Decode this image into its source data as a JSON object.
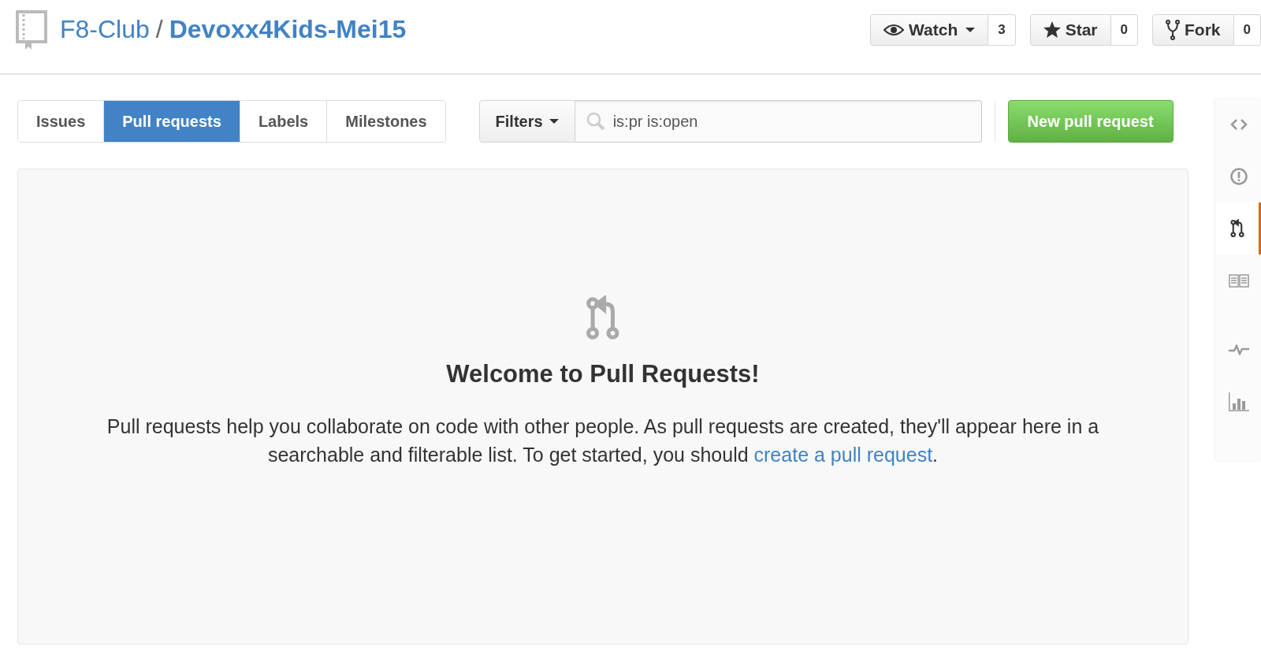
{
  "repo": {
    "owner": "F8-Club",
    "separator": "/",
    "name": "Devoxx4Kids-Mei15"
  },
  "repo_actions": [
    {
      "kind": "watch",
      "label": "Watch",
      "count": "3",
      "dropdown": true
    },
    {
      "kind": "star",
      "label": "Star",
      "count": "0",
      "dropdown": false
    },
    {
      "kind": "fork",
      "label": "Fork",
      "count": "0",
      "dropdown": false
    }
  ],
  "tabs": [
    {
      "label": "Issues",
      "selected": false
    },
    {
      "label": "Pull requests",
      "selected": true
    },
    {
      "label": "Labels",
      "selected": false
    },
    {
      "label": "Milestones",
      "selected": false
    }
  ],
  "filters_button": {
    "label": "Filters"
  },
  "search": {
    "value": "is:pr is:open"
  },
  "new_button": {
    "label": "New pull request"
  },
  "blankslate": {
    "title": "Welcome to Pull Requests!",
    "text_before_link": "Pull requests help you collaborate on code with other people. As pull requests are created, they'll appear here in a searchable and filterable list. To get started, you should",
    "link": "create a pull request",
    "text_after_link": "."
  },
  "sidebar": {
    "items": [
      {
        "kind": "code",
        "selected": false
      },
      {
        "kind": "issues",
        "selected": false
      },
      {
        "kind": "pulls",
        "selected": true
      },
      {
        "kind": "wiki",
        "selected": false
      },
      {
        "kind": "pulse",
        "selected": false
      },
      {
        "kind": "graphs",
        "selected": false
      }
    ]
  }
}
